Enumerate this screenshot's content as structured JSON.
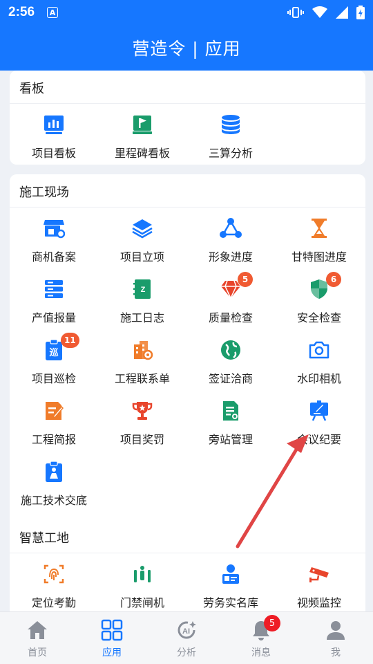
{
  "status_bar": {
    "time": "2:56",
    "a_icon": "A"
  },
  "header": {
    "title": "营造令 | 应用"
  },
  "sections": {
    "kanban": {
      "title": "看板",
      "items": [
        "项目看板",
        "里程碑看板",
        "三算分析"
      ]
    },
    "site": {
      "title": "施工现场",
      "items": [
        "商机备案",
        "项目立项",
        "形象进度",
        "甘特图进度",
        "产值报量",
        "施工日志",
        "质量检查",
        "安全检查",
        "项目巡检",
        "工程联系单",
        "签证洽商",
        "水印相机",
        "工程简报",
        "项目奖罚",
        "旁站管理",
        "会议纪要",
        "施工技术交底"
      ],
      "badges": {
        "quality": "5",
        "safety": "6",
        "patrol": "11"
      }
    },
    "smart": {
      "title": "智慧工地",
      "items": [
        "定位考勤",
        "门禁闸机",
        "劳务实名库",
        "视频监控"
      ]
    }
  },
  "tabs": [
    {
      "label": "首页"
    },
    {
      "label": "应用"
    },
    {
      "label": "分析"
    },
    {
      "label": "消息",
      "badge": "5"
    },
    {
      "label": "我"
    }
  ],
  "colors": {
    "brand": "#1677ff",
    "orange": "#f07c2a",
    "green": "#1a9c6b",
    "badge": "#f05a32"
  }
}
